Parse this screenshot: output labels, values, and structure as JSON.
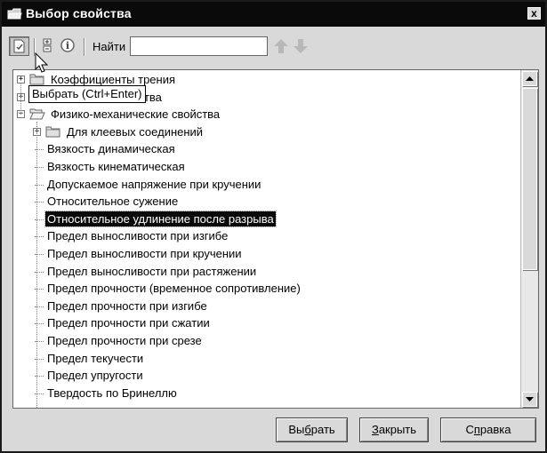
{
  "window": {
    "title": "Выбор свойства",
    "close_label": "x"
  },
  "toolbar": {
    "find_label": "Найти",
    "find_value": "",
    "find_placeholder": ""
  },
  "tooltip": {
    "text": "Выбрать (Ctrl+Enter)"
  },
  "tree": {
    "items": [
      {
        "label": "Коэффициенты трения",
        "type": "folder",
        "expander": "+"
      },
      {
        "label": "Магнитные свойства",
        "type": "folder",
        "expander": "+"
      },
      {
        "label": "Физико-механические свойства",
        "type": "folder-open",
        "expander": "−"
      },
      {
        "label": "Для клеевых соединений",
        "type": "folder",
        "expander": "+"
      },
      {
        "label": "Вязкость динамическая",
        "type": "leaf"
      },
      {
        "label": "Вязкость кинематическая",
        "type": "leaf"
      },
      {
        "label": "Допускаемое напряжение при кручении",
        "type": "leaf"
      },
      {
        "label": "Относительное сужение",
        "type": "leaf"
      },
      {
        "label": "Относительное удлинение после разрыва",
        "type": "leaf",
        "selected": true
      },
      {
        "label": "Предел выносливости при изгибе",
        "type": "leaf"
      },
      {
        "label": "Предел выносливости при кручении",
        "type": "leaf"
      },
      {
        "label": "Предел выносливости при растяжении",
        "type": "leaf"
      },
      {
        "label": "Предел прочности (временное сопротивление)",
        "type": "leaf"
      },
      {
        "label": "Предел прочности при изгибе",
        "type": "leaf"
      },
      {
        "label": "Предел прочности при сжатии",
        "type": "leaf"
      },
      {
        "label": "Предел прочности при срезе",
        "type": "leaf"
      },
      {
        "label": "Предел текучести",
        "type": "leaf"
      },
      {
        "label": "Предел упругости",
        "type": "leaf"
      },
      {
        "label": "Твердость по Бринеллю",
        "type": "leaf"
      }
    ]
  },
  "buttons": {
    "select": {
      "before": "Вы",
      "accel": "б",
      "after": "рать"
    },
    "close": {
      "before": "",
      "accel": "З",
      "after": "акрыть"
    },
    "help": {
      "before": "С",
      "accel": "п",
      "after": "равка"
    }
  },
  "colors": {
    "title_bg": "#0a0a0a",
    "selection_bg": "#0a0a0a",
    "dialog_bg": "#d9d9d9",
    "disabled_arrow": "#b8b8b8"
  },
  "icons": [
    "app-icon",
    "select-icon",
    "expand-all-icon",
    "info-icon",
    "arrow-up-icon",
    "arrow-down-icon",
    "folder-icon",
    "folder-open-icon",
    "pointer-cursor"
  ]
}
